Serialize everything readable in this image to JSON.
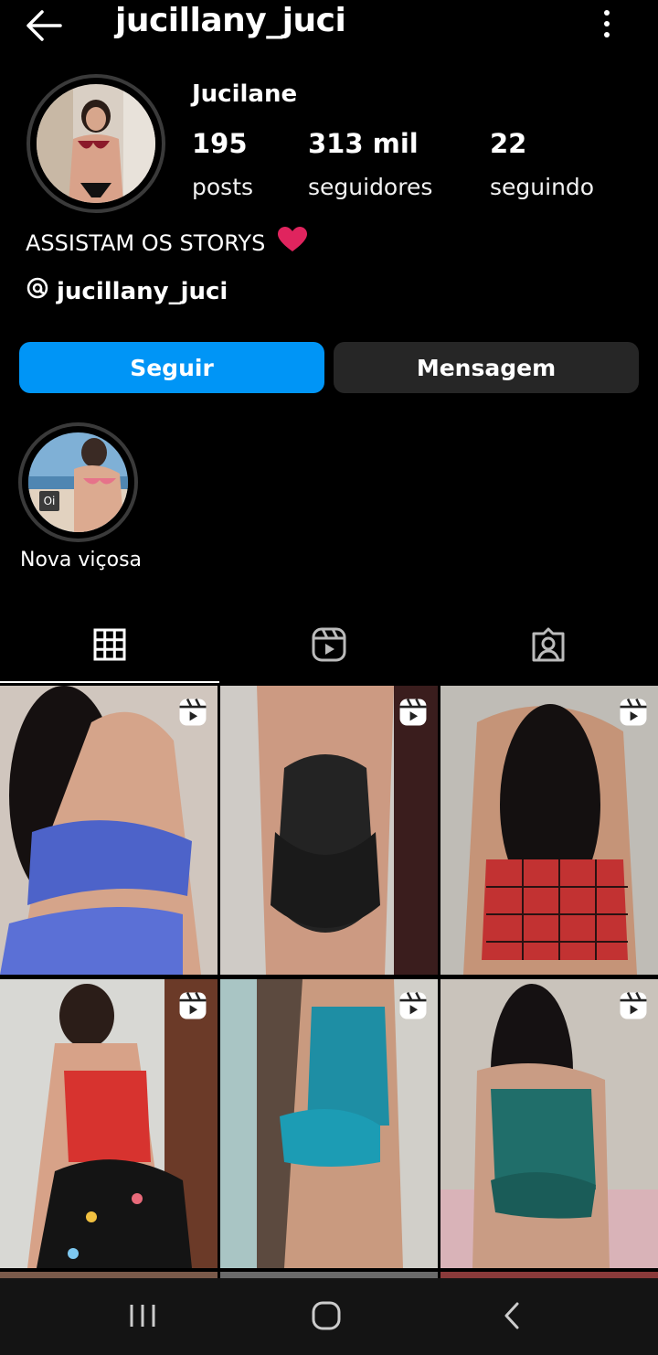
{
  "header": {
    "username": "jucillany_juci"
  },
  "profile": {
    "full_name": "Jucilane",
    "stats": [
      {
        "value": "195",
        "label": "posts"
      },
      {
        "value": "313 mil",
        "label": "seguidores"
      },
      {
        "value": "22",
        "label": "seguindo"
      }
    ],
    "bio": "ASSISTAM OS STORYS",
    "threads_handle": "jucillany_juci"
  },
  "actions": {
    "follow_label": "Seguir",
    "message_label": "Mensagem"
  },
  "highlights": [
    {
      "label": "Nova viçosa",
      "badge": "Oi"
    }
  ],
  "tabs": [
    {
      "name": "posts-grid",
      "icon": "grid-icon",
      "active": true
    },
    {
      "name": "reels",
      "icon": "reels-icon",
      "active": false
    },
    {
      "name": "tagged",
      "icon": "tagged-icon",
      "active": false
    }
  ],
  "grid_posts": [
    {
      "type": "reel",
      "icon": "reels-icon"
    },
    {
      "type": "reel",
      "icon": "reels-icon"
    },
    {
      "type": "reel",
      "icon": "reels-icon"
    },
    {
      "type": "reel",
      "icon": "reels-icon"
    },
    {
      "type": "reel",
      "icon": "reels-icon"
    },
    {
      "type": "reel",
      "icon": "reels-icon"
    }
  ],
  "colors": {
    "accent": "#0095f6",
    "button_dark": "#262626",
    "background": "#000000"
  }
}
